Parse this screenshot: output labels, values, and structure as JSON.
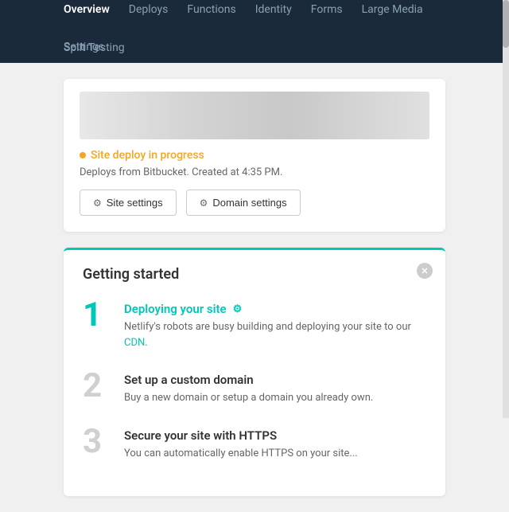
{
  "navbar": {
    "items": [
      {
        "label": "Overview",
        "active": true
      },
      {
        "label": "Deploys",
        "active": false
      },
      {
        "label": "Functions",
        "active": false
      },
      {
        "label": "Identity",
        "active": false
      },
      {
        "label": "Forms",
        "active": false
      },
      {
        "label": "Large Media",
        "active": false
      },
      {
        "label": "Split Testing",
        "active": false
      }
    ],
    "settings_label": "Settings"
  },
  "site_card": {
    "status_dot": "●",
    "status_text": "Site deploy in progress",
    "meta_text": "Deploys from Bitbucket. Created at 4:35 PM.",
    "btn_site_settings": "Site settings",
    "btn_domain_settings": "Domain settings"
  },
  "getting_started": {
    "title": "Getting started",
    "close_icon": "✕",
    "steps": [
      {
        "number": "1",
        "active": true,
        "title": "Deploying your site",
        "has_gear": true,
        "description": "Netlify's robots are busy building and deploying your site to our CDN."
      },
      {
        "number": "2",
        "active": false,
        "title": "Set up a custom domain",
        "has_gear": false,
        "description": "Buy a new domain or setup a domain you already own."
      },
      {
        "number": "3",
        "active": false,
        "title": "Secure your site with HTTPS",
        "has_gear": false,
        "description": "You can automatically enable HTTPS on your site..."
      }
    ]
  }
}
